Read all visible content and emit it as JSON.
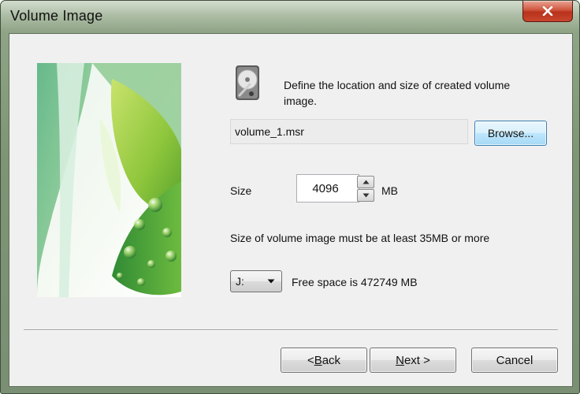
{
  "window": {
    "title": "Volume Image",
    "close_icon": "close-icon"
  },
  "description": "Define the location and size of created volume image.",
  "path": {
    "value": "volume_1.msr",
    "browse_label": "Browse..."
  },
  "size": {
    "label": "Size",
    "value": "4096",
    "unit": "MB"
  },
  "hint": "Size of volume image must be at least 35MB or more",
  "drive": {
    "selected": "J:",
    "free_space": "Free space is 472749 MB"
  },
  "buttons": {
    "back_prefix": "< ",
    "back_mnemonic": "B",
    "back_rest": "ack",
    "next_mnemonic": "N",
    "next_rest": "ext >",
    "cancel": "Cancel"
  },
  "icons": [
    "close-icon",
    "disk-icon",
    "spin-up-icon",
    "spin-down-icon",
    "chevron-down-icon"
  ]
}
